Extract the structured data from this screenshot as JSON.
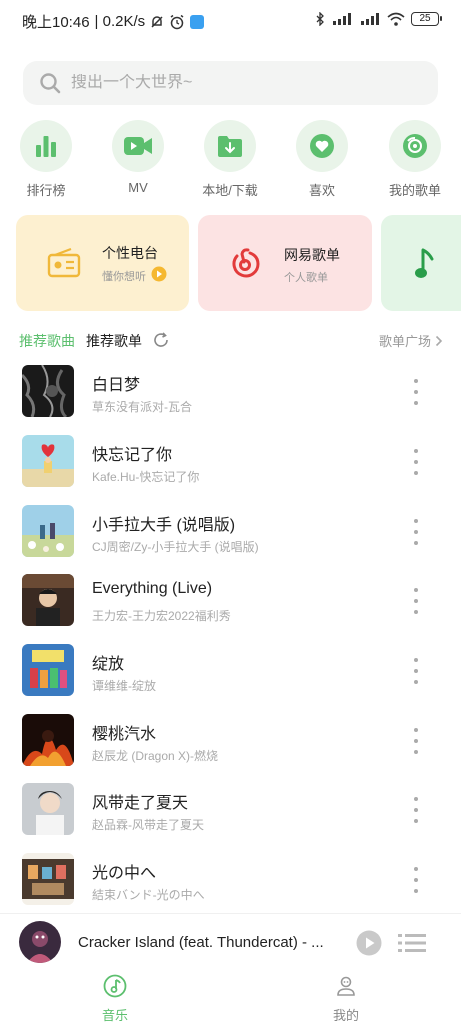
{
  "status": {
    "time": "晚上10:46",
    "net_speed": "| 0.2K/s",
    "battery": "25"
  },
  "search": {
    "placeholder": "搜出一个大世界~"
  },
  "quick_nav": [
    {
      "label": "排行榜",
      "icon": "bar-chart-icon"
    },
    {
      "label": "MV",
      "icon": "video-camera-icon"
    },
    {
      "label": "本地/下载",
      "icon": "download-folder-icon"
    },
    {
      "label": "喜欢",
      "icon": "heart-icon"
    },
    {
      "label": "我的歌单",
      "icon": "vinyl-icon"
    }
  ],
  "cards": [
    {
      "title": "个性电台",
      "subtitle": "懂你想听",
      "icon": "radio-icon"
    },
    {
      "title": "网易歌单",
      "subtitle": "个人歌单",
      "icon": "netease-icon"
    },
    {
      "title": "",
      "subtitle": "",
      "icon": "music-note-icon"
    }
  ],
  "section": {
    "tab_active": "推荐歌曲",
    "tab": "推荐歌单",
    "right_link": "歌单广场"
  },
  "songs": [
    {
      "title": "白日梦",
      "subtitle": "草东没有派对-瓦合"
    },
    {
      "title": "快忘记了你",
      "subtitle": "Kafe.Hu-快忘记了你"
    },
    {
      "title": "小手拉大手 (说唱版)",
      "subtitle": "CJ周密/Zy-小手拉大手 (说唱版)"
    },
    {
      "title": "Everything (Live)",
      "subtitle": "王力宏-王力宏2022福利秀"
    },
    {
      "title": "绽放",
      "subtitle": "谭维维-绽放"
    },
    {
      "title": "樱桃汽水",
      "subtitle": "赵辰龙 (Dragon X)-燃烧"
    },
    {
      "title": "风带走了夏天",
      "subtitle": "赵品霖-风带走了夏天"
    },
    {
      "title": "光の中へ",
      "subtitle": "結束バンド-光の中へ"
    }
  ],
  "player": {
    "title": "Cracker Island (feat. Thundercat) - ..."
  },
  "bottom_nav": [
    {
      "label": "音乐",
      "active": true
    },
    {
      "label": "我的",
      "active": false
    }
  ],
  "colors": {
    "accent": "#5cbf6e",
    "card_radio": "#fdf0d0",
    "card_netease": "#fce3e3",
    "card_third": "#e3f5e6"
  }
}
